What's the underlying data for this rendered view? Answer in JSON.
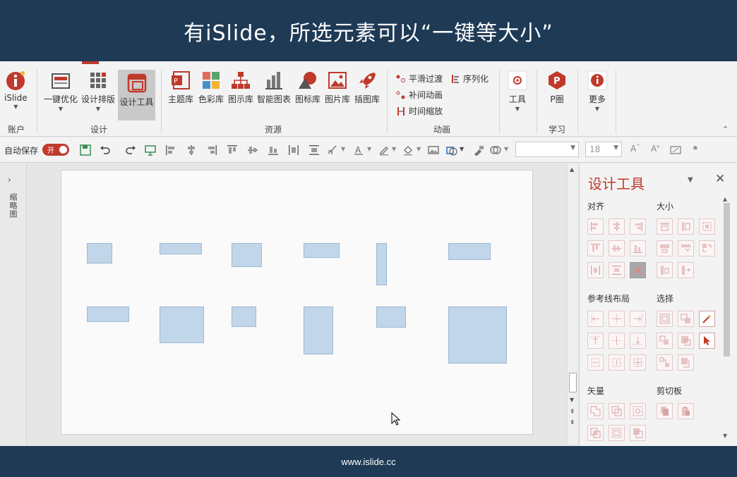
{
  "banner": {
    "text": "有iSlide，所选元素可以“一键等大小”"
  },
  "footer": {
    "url": "www.islide.cc"
  },
  "ribbon": {
    "account": {
      "label": "iSlide",
      "group": "账户"
    },
    "design": {
      "group": "设计",
      "items": [
        "一键优化",
        "设计排版",
        "设计工具"
      ]
    },
    "resources": {
      "group": "资源",
      "items": [
        "主题库",
        "色彩库",
        "图示库",
        "智能图表",
        "图标库",
        "图片库",
        "插图库"
      ]
    },
    "animation": {
      "group": "动画",
      "items": [
        "平滑过渡",
        "序列化",
        "补间动画",
        "时间缩放"
      ]
    },
    "tools": {
      "label": "工具"
    },
    "learn": {
      "label": "P圈",
      "group": "学习"
    },
    "more": {
      "label": "更多"
    }
  },
  "qat": {
    "autosave_label": "自动保存",
    "toggle_label": "开",
    "font_size": "18"
  },
  "leftpane": {
    "label": "缩略图"
  },
  "panel": {
    "title": "设计工具",
    "sections": {
      "align": "对齐",
      "size": "大小",
      "guides": "参考线布局",
      "select": "选择",
      "vector": "矢量",
      "clipboard": "剪切板"
    }
  },
  "colors": {
    "banner": "#1e3a55",
    "accent": "#c0392b",
    "shape_fill": "#c2d6ea",
    "shape_border": "#9ab9d6"
  }
}
